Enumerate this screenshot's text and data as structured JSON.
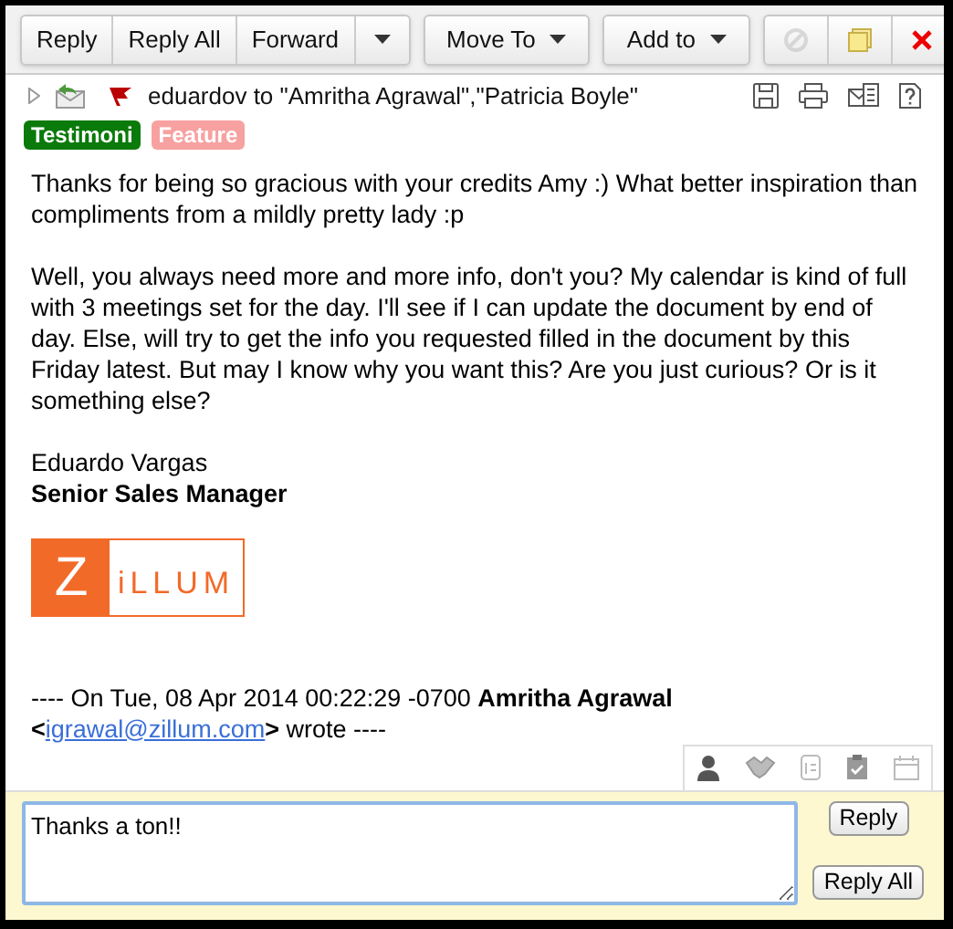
{
  "toolbar": {
    "groups": [
      {
        "buttons": [
          {
            "kind": "text",
            "label": "Reply"
          },
          {
            "kind": "text",
            "label": "Reply All"
          },
          {
            "kind": "text",
            "label": "Forward"
          },
          {
            "kind": "caret"
          }
        ]
      },
      {
        "buttons": [
          {
            "kind": "menu",
            "label": "Move To"
          }
        ]
      },
      {
        "buttons": [
          {
            "kind": "menu",
            "label": "Add to"
          }
        ]
      },
      {
        "buttons": [
          {
            "kind": "block",
            "disabled": true
          },
          {
            "kind": "note",
            "disabled": false
          },
          {
            "kind": "delete",
            "disabled": false
          }
        ]
      }
    ]
  },
  "header": {
    "expanded": false,
    "flagged": true,
    "from_to": "eduardov to \"Amritha Agrawal\",\"Patricia Boyle\""
  },
  "tags": [
    {
      "label": "Testimoni",
      "color": "#0a7a0a"
    },
    {
      "label": "Feature",
      "color": "#f7a1a1"
    }
  ],
  "body": {
    "paragraphs": [
      "Thanks for being so gracious with your credits Amy :) What better inspiration than compliments from a mildly pretty lady :p",
      "Well, you always need more and more info, don't you? My calendar is kind of full with 3 meetings set for the day. I'll see if I can update the document by end of day. Else, will try to get the info you requested filled in the document by this Friday latest. But may I know why you want this? Are you just curious? Or is it something else?"
    ],
    "signature": {
      "name": "Eduardo Vargas",
      "title": "Senior Sales Manager"
    },
    "logo": {
      "initial": "Z",
      "rest": "iLLUM"
    },
    "quote": {
      "prefix": "---- On Tue, 08 Apr 2014 00:22:29 -0700 **Amritha Agrawal**",
      "open": "<",
      "email": "igrawal@zillum.com",
      "close": ">",
      "suffix": "wrote ----"
    }
  },
  "reply": {
    "value": "Thanks a ton!!",
    "buttons": [
      "Reply",
      "Reply All"
    ]
  }
}
